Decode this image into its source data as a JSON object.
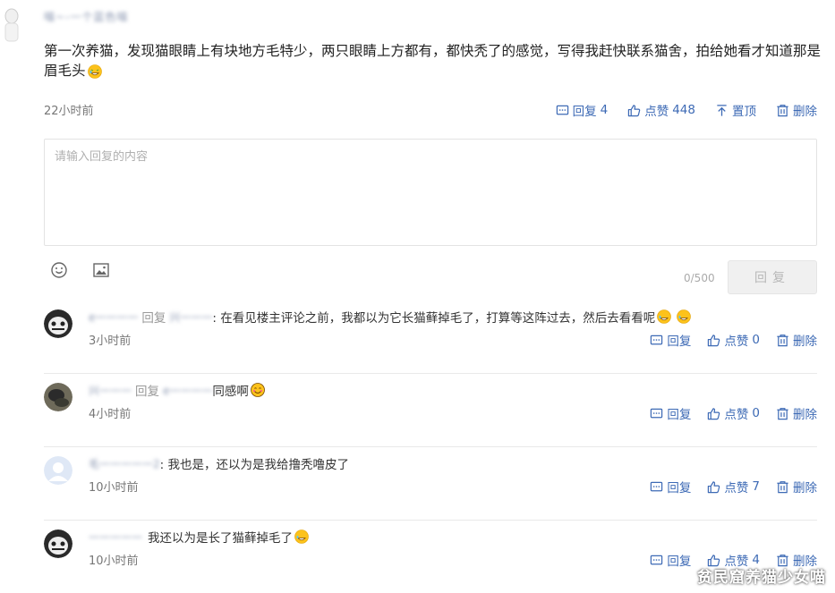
{
  "main_comment": {
    "username": "喵~-一个蓝色喵",
    "text": "第一次养猫，发现猫眼睛上有块地方毛特少，两只眼睛上方都有，都快秃了的感觉，写得我赶快联系猫舍，拍给她看才知道那是眉毛头",
    "time": "22小时前",
    "actions": {
      "reply_label": "回复",
      "reply_count": "4",
      "like_label": "点赞",
      "like_count": "448",
      "pin_label": "置顶",
      "delete_label": "删除"
    }
  },
  "reply_box": {
    "placeholder": "请输入回复的内容",
    "char_count": "0/500",
    "submit_label": "回复"
  },
  "replies": [
    {
      "username": "e一一一一",
      "reply_word": "回复",
      "reply_to": "兴一一一",
      "text": ": 在看见楼主评论之前，我都以为它长猫藓掉毛了，打算等这阵过去，然后去看看呢",
      "time": "3小时前",
      "reply_label": "回复",
      "like_label": "点赞",
      "like_count": "0",
      "delete_label": "删除"
    },
    {
      "username": "兴一一一",
      "reply_word": "回复",
      "reply_to": "e一一一一",
      "text": "同感啊",
      "time": "4小时前",
      "reply_label": "回复",
      "like_label": "点赞",
      "like_count": "0",
      "delete_label": "删除"
    },
    {
      "username": "毛一一一一一2",
      "text": ": 我也是，还以为是我给撸秃噜皮了",
      "time": "10小时前",
      "reply_label": "回复",
      "like_label": "点赞",
      "like_count": "7",
      "delete_label": "删除"
    },
    {
      "username": "一一一一一",
      "text": "我还以为是长了猫藓掉毛了",
      "time": "10小时前",
      "reply_label": "回复",
      "like_label": "点赞",
      "like_count": "4",
      "delete_label": "删除"
    }
  ],
  "watermark": "贫民窟养猫少女喵",
  "colors": {
    "accent": "#3d6ab5",
    "muted": "#777777",
    "border": "#e3e3e3"
  }
}
